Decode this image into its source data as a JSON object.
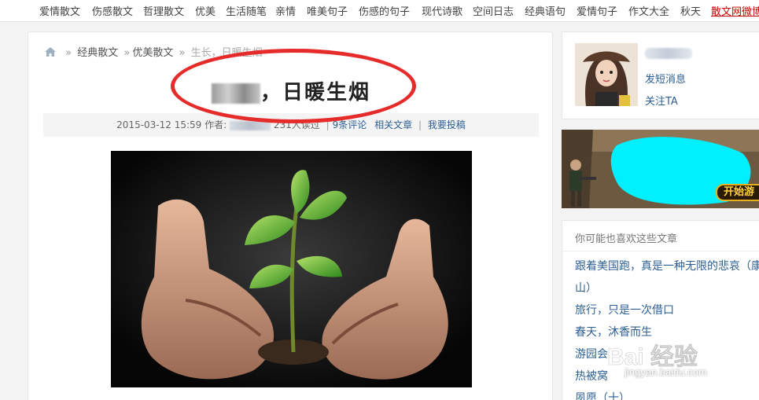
{
  "topnav": {
    "items": [
      {
        "label": "爱情散文"
      },
      {
        "label": "伤感散文"
      },
      {
        "label": "哲理散文"
      },
      {
        "label": "优美"
      },
      {
        "label": "生活随笔"
      },
      {
        "label": "亲情"
      },
      {
        "label": "唯美句子"
      },
      {
        "label": "伤感的句子"
      },
      {
        "label": "现代诗歌"
      },
      {
        "label": "空间日志"
      },
      {
        "label": "经典语句"
      },
      {
        "label": "爱情句子"
      },
      {
        "label": "作文大全"
      },
      {
        "label": "秋天"
      },
      {
        "label": "散文网微博"
      }
    ]
  },
  "breadcrumb": {
    "level1": "经典散文",
    "level2": "优美散文",
    "current": "生长，日暖生烟",
    "separator": "»"
  },
  "article": {
    "title_visible": "，日暖生烟",
    "meta": {
      "date": "2015-03-12 15:59",
      "author_label": "作者:",
      "reads": "231人读过",
      "comments": "9条评论",
      "related": "相关文章",
      "submit": "我要投稿",
      "pipe": "|"
    }
  },
  "profile": {
    "send_message": "发短消息",
    "follow": "关注TA"
  },
  "ad": {
    "button_text": "开始游"
  },
  "recommend": {
    "heading": "你可能也喜欢这些文章",
    "items": [
      {
        "title": "跟着美国跑，真是一种无限的悲哀（康"
      },
      {
        "title": "山）"
      },
      {
        "title": "旅行，只是一次借口"
      },
      {
        "title": "春天，沐香而生"
      },
      {
        "title": "游园会"
      },
      {
        "title": "热被窝"
      },
      {
        "title": "夙愿（十）"
      }
    ]
  },
  "watermark": {
    "brand": "Bai 经验",
    "url": "jingyan.baidu.com"
  },
  "colors": {
    "link": "#2c5f93",
    "annotation": "#e62b2b",
    "ad_cyan": "#00f0ff"
  },
  "icons": {
    "home": "home-icon"
  }
}
